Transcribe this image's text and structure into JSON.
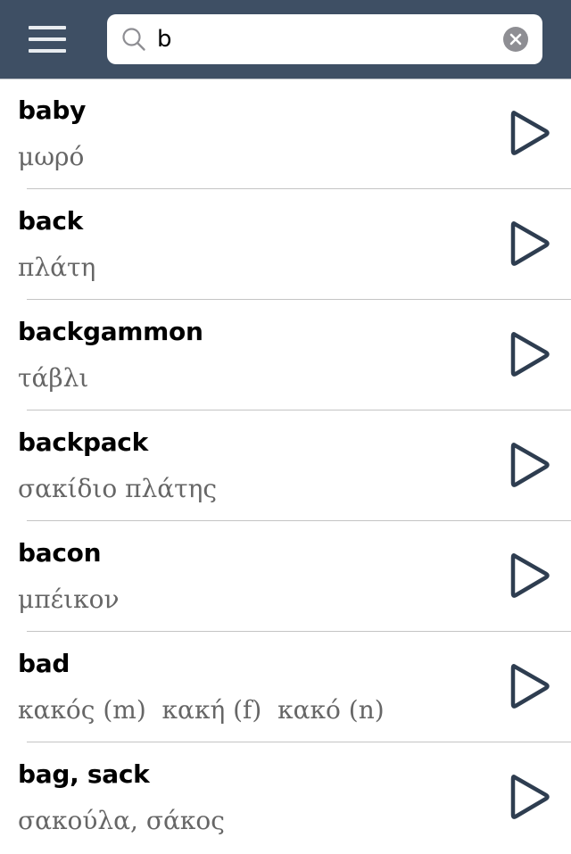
{
  "header": {
    "menu_icon": "hamburger-menu-icon",
    "search": {
      "value": "b",
      "placeholder": "",
      "search_icon": "magnifier-icon",
      "clear_icon": "clear-x-icon"
    }
  },
  "colors": {
    "header_bg": "#3e4f64",
    "accent": "#2e3d50",
    "translation_text": "#666666",
    "clear_button": "#8e8e93"
  },
  "entries": [
    {
      "term": "baby",
      "translation": "μωρό",
      "action_icon": "play-icon"
    },
    {
      "term": "back",
      "translation": "πλάτη",
      "action_icon": "play-icon"
    },
    {
      "term": "backgammon",
      "translation": "τάβλι",
      "action_icon": "play-icon"
    },
    {
      "term": "backpack",
      "translation": "σακίδιο πλάτης",
      "action_icon": "play-icon"
    },
    {
      "term": "bacon",
      "translation": "μπέικον",
      "action_icon": "play-icon"
    },
    {
      "term": "bad",
      "translation": "κακός (m)  κακή (f)  κακό (n)",
      "action_icon": "play-icon"
    },
    {
      "term": "bag, sack",
      "translation": "σακούλα, σάκος",
      "action_icon": "play-icon"
    }
  ]
}
